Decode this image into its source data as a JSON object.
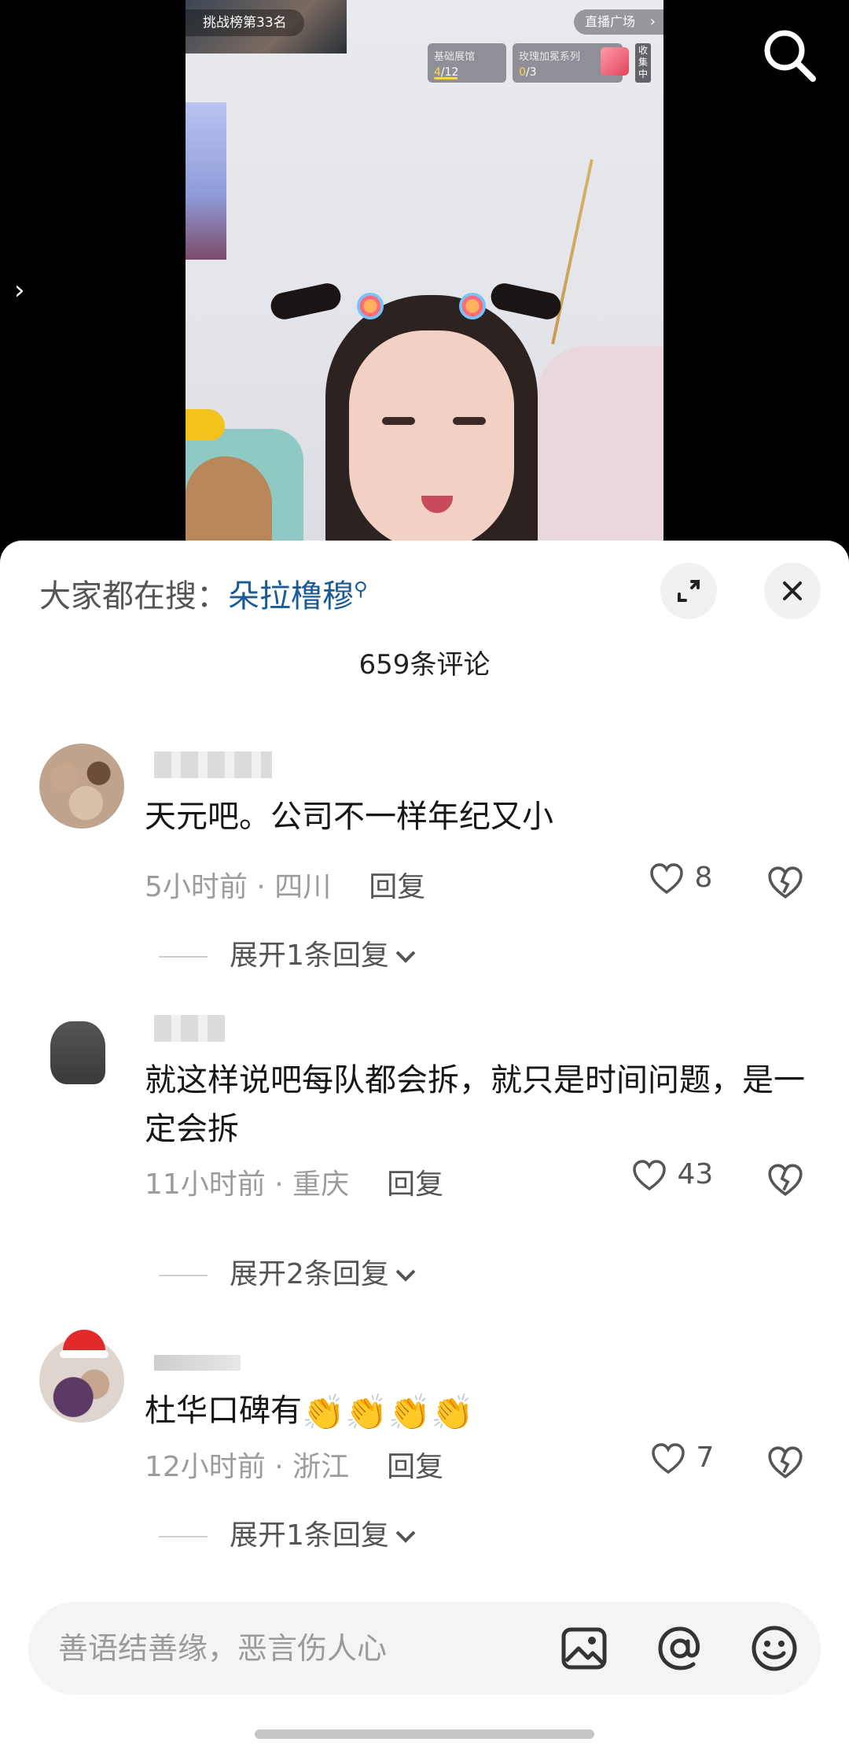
{
  "live": {
    "rank_label": "挑战榜第33名",
    "plaza_label": "直播广场",
    "task1": {
      "name": "基础展馆",
      "done": "4",
      "total": "/12"
    },
    "task2": {
      "name": "玫瑰加冕系列",
      "done": "0",
      "total": "/3"
    },
    "collect_tag": "收集中",
    "icons": {
      "search": "search-icon",
      "expand": "chevron-right-icon"
    }
  },
  "sheet": {
    "hot_search_label": "大家都在搜：",
    "hot_search_term": "朵拉橹穆",
    "comment_count": "659条评论"
  },
  "comments": [
    {
      "text": "天元吧。公司不一样年纪又小",
      "time": "5小时前",
      "sep": " · ",
      "location": "四川",
      "reply": "回复",
      "likes": "8",
      "expand": "展开1条回复"
    },
    {
      "text": "就这样说吧每队都会拆，就只是时间问题，是一定会拆",
      "time": "11小时前",
      "sep": " · ",
      "location": "重庆",
      "reply": "回复",
      "likes": "43",
      "expand": "展开2条回复"
    },
    {
      "text": "杜华口碑有",
      "time": "12小时前",
      "sep": " · ",
      "location": "浙江",
      "reply": "回复",
      "likes": "7",
      "expand": "展开1条回复"
    }
  ],
  "input": {
    "placeholder": "善语结善缘，恶言伤人心",
    "icons": [
      "image-icon",
      "at-icon",
      "emoji-icon"
    ]
  },
  "colors": {
    "link": "#1a5a96",
    "muted": "#9c9c9c",
    "sheet_bg": "#ffffff"
  }
}
